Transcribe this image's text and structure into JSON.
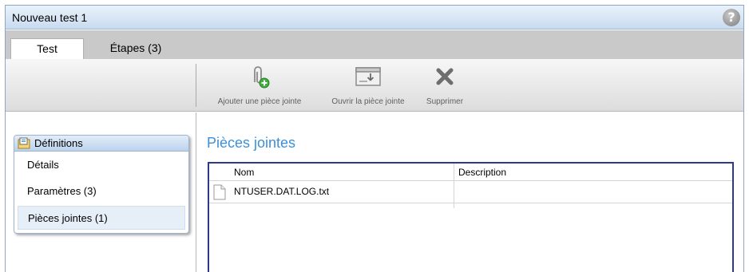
{
  "window": {
    "title": "Nouveau test 1",
    "help_label": "?"
  },
  "tabs": [
    {
      "label": "Test",
      "active": true
    },
    {
      "label": "Étapes (3)",
      "active": false
    }
  ],
  "toolbar": {
    "add_label": "Ajouter une pièce jointe",
    "open_label": "Ouvrir la pièce jointe",
    "delete_label": "Supprimer"
  },
  "sidebar": {
    "panel_title": "Définitions",
    "items": [
      {
        "label": "Détails",
        "selected": false
      },
      {
        "label": "Paramètres (3)",
        "selected": false
      },
      {
        "label": "Pièces jointes (1)",
        "selected": true
      }
    ]
  },
  "main": {
    "heading": "Pièces jointes",
    "columns": [
      "Nom",
      "Description"
    ],
    "rows": [
      {
        "name": "NTUSER.DAT.LOG.txt",
        "description": ""
      }
    ]
  },
  "colors": {
    "heading": "#3c8fd8",
    "grid_border": "#2b3a8f",
    "selected_item": "#e6eef8"
  }
}
